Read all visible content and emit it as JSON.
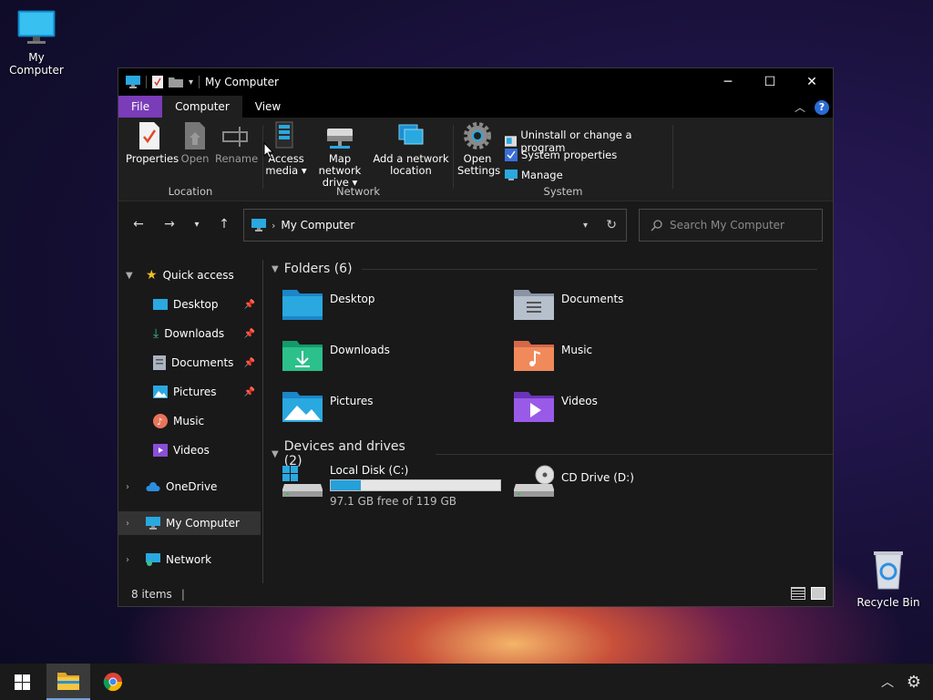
{
  "desktop": {
    "icons": [
      {
        "label": "My Computer"
      },
      {
        "label": "Recycle Bin"
      }
    ]
  },
  "window": {
    "title": "My Computer",
    "controls": {
      "minimize": "─",
      "maximize": "☐",
      "close": "✕"
    }
  },
  "ribbon": {
    "tabs": [
      "File",
      "Computer",
      "View"
    ],
    "active_tab": "Computer",
    "groups": {
      "location": {
        "name": "Location",
        "buttons": [
          {
            "label": "Properties"
          },
          {
            "label": "Open"
          },
          {
            "label": "Rename"
          }
        ]
      },
      "network": {
        "name": "Network",
        "buttons": [
          {
            "label": "Access media ▾"
          },
          {
            "label": "Map network drive ▾"
          },
          {
            "label": "Add a network location"
          }
        ]
      },
      "system": {
        "name": "System",
        "open_settings": "Open Settings",
        "items": [
          {
            "label": "Uninstall or change a program"
          },
          {
            "label": "System properties"
          },
          {
            "label": "Manage"
          }
        ]
      }
    }
  },
  "address": {
    "path": "My Computer",
    "search_placeholder": "Search My Computer"
  },
  "sidebar": {
    "quick_access": "Quick access",
    "items": [
      {
        "label": "Desktop",
        "pinned": true
      },
      {
        "label": "Downloads",
        "pinned": true
      },
      {
        "label": "Documents",
        "pinned": true
      },
      {
        "label": "Pictures",
        "pinned": true
      },
      {
        "label": "Music",
        "pinned": false
      },
      {
        "label": "Videos",
        "pinned": false
      }
    ],
    "onedrive": "OneDrive",
    "mycomputer": "My Computer",
    "network": "Network"
  },
  "content": {
    "folders_header": "Folders (6)",
    "folders": [
      "Desktop",
      "Documents",
      "Downloads",
      "Music",
      "Pictures",
      "Videos"
    ],
    "drives_header": "Devices and drives (2)",
    "drives": [
      {
        "name": "Local Disk (C:)",
        "free_text": "97.1 GB free of 119 GB",
        "used_fraction": 0.18
      },
      {
        "name": "CD Drive (D:)"
      }
    ]
  },
  "status": {
    "items_count": "8 items"
  },
  "colors": {
    "file_tab": "#7a3cb8",
    "accent": "#26a0da"
  }
}
